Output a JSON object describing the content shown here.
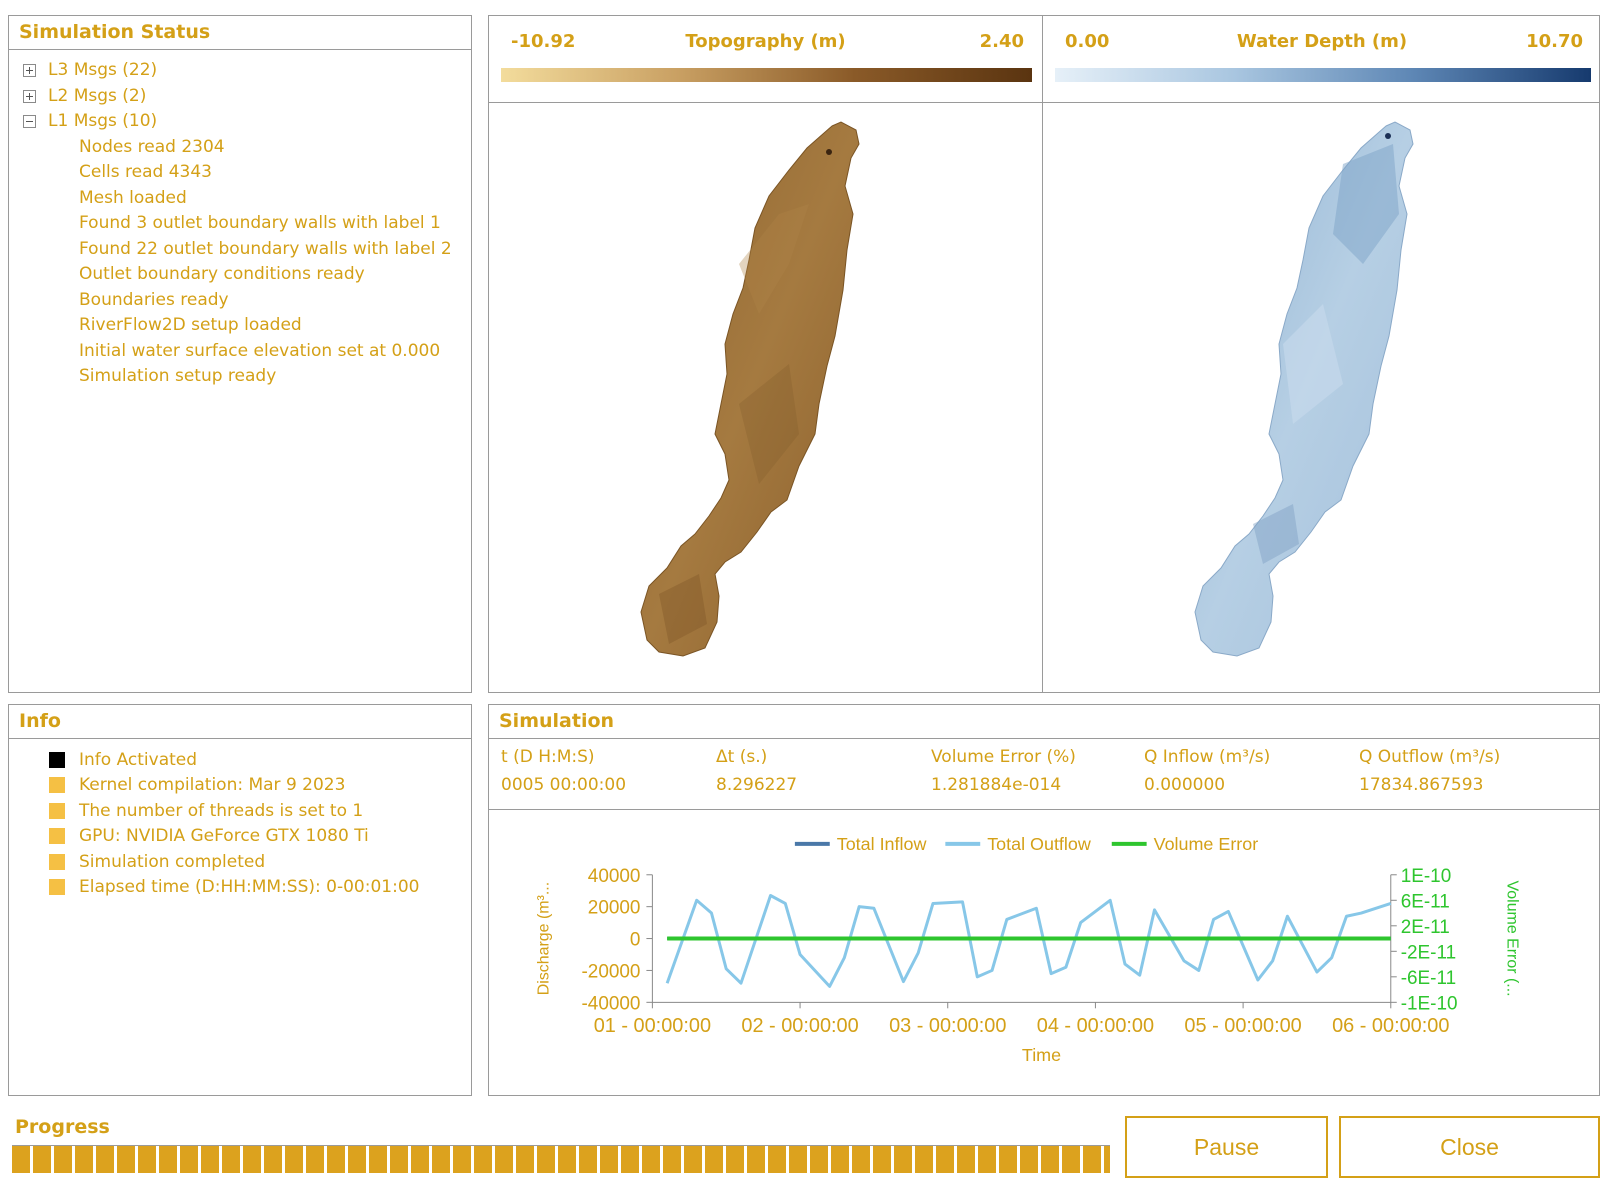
{
  "status_panel": {
    "title": "Simulation Status",
    "groups": [
      {
        "label": "L3 Msgs (22)",
        "expanded": false
      },
      {
        "label": "L2 Msgs (2)",
        "expanded": false
      },
      {
        "label": "L1 Msgs (10)",
        "expanded": true
      }
    ],
    "l1_messages": [
      "Nodes read 2304",
      "Cells read 4343",
      "Mesh loaded",
      "Found 3 outlet boundary walls with label 1",
      "Found 22 outlet boundary walls with label 2",
      "Outlet boundary conditions ready",
      "Boundaries ready",
      "RiverFlow2D setup loaded",
      "Initial water surface elevation set at 0.000",
      "Simulation setup ready"
    ]
  },
  "topography": {
    "title": "Topography (m)",
    "min": "-10.92",
    "max": "2.40"
  },
  "water_depth": {
    "title": "Water Depth (m)",
    "min": "0.00",
    "max": "10.70"
  },
  "info_panel": {
    "title": "Info",
    "items": [
      {
        "text": "Info Activated",
        "color": "#000000"
      },
      {
        "text": "Kernel compilation: Mar  9 2023",
        "color": "#f5c044"
      },
      {
        "text": "The number of threads is set to 1",
        "color": "#f5c044"
      },
      {
        "text": "GPU: NVIDIA GeForce GTX 1080 Ti",
        "color": "#f5c044"
      },
      {
        "text": "Simulation completed",
        "color": "#f5c044"
      },
      {
        "text": "Elapsed time (D:HH:MM:SS): 0-00:01:00",
        "color": "#f5c044"
      }
    ]
  },
  "simulation_panel": {
    "title": "Simulation",
    "headers": {
      "time": "t (D H:M:S)",
      "dt": "Δt (s.)",
      "volume_error": "Volume Error (%)",
      "q_inflow": "Q Inflow (m³/s)",
      "q_outflow": "Q Outflow (m³/s)"
    },
    "values": {
      "time": "0005 00:00:00",
      "dt": "8.296227",
      "volume_error": "1.281884e-014",
      "q_inflow": "0.000000",
      "q_outflow": "17834.867593"
    }
  },
  "chart_data": {
    "type": "line",
    "xlabel": "Time",
    "ylabel": "Discharge (m³...",
    "y2label": "Volume Error (...",
    "ylim": [
      -40000,
      40000
    ],
    "y2lim": [
      -1e-10,
      1e-10
    ],
    "yticks": [
      "40000",
      "20000",
      "0",
      "-20000",
      "-40000"
    ],
    "y2ticks": [
      "1E-10",
      "6E-11",
      "2E-11",
      "-2E-11",
      "-6E-11",
      "-1E-10"
    ],
    "xticks": [
      "01 - 00:00:00",
      "02 - 00:00:00",
      "03 - 00:00:00",
      "04 - 00:00:00",
      "05 - 00:00:00",
      "06 - 00:00:00"
    ],
    "xlim": [
      1.1,
      6.0
    ],
    "legend": {
      "position": "top-center"
    },
    "series": [
      {
        "name": "Total Inflow",
        "color": "#4a78a8",
        "axis": "left",
        "x": [
          1.1,
          6.0
        ],
        "y": [
          0,
          0
        ]
      },
      {
        "name": "Total Outflow",
        "color": "#87c7e8",
        "axis": "left",
        "x": [
          1.1,
          1.3,
          1.4,
          1.5,
          1.6,
          1.8,
          1.9,
          2.0,
          2.2,
          2.3,
          2.4,
          2.5,
          2.7,
          2.8,
          2.9,
          3.1,
          3.2,
          3.3,
          3.4,
          3.6,
          3.7,
          3.8,
          3.9,
          4.1,
          4.2,
          4.3,
          4.4,
          4.6,
          4.7,
          4.8,
          4.9,
          5.1,
          5.2,
          5.3,
          5.5,
          5.6,
          5.7,
          5.8,
          6.0
        ],
        "y": [
          -28000,
          24000,
          16000,
          -19000,
          -28000,
          27000,
          22000,
          -10000,
          -30000,
          -12000,
          20000,
          19000,
          -27000,
          -9000,
          22000,
          23000,
          -24000,
          -20000,
          12000,
          19000,
          -22000,
          -18000,
          10000,
          24000,
          -16000,
          -23000,
          18000,
          -14000,
          -20000,
          12000,
          17000,
          -26000,
          -14000,
          14000,
          -21000,
          -12000,
          14000,
          16000,
          22000
        ]
      },
      {
        "name": "Volume Error",
        "color": "#2ec52e",
        "axis": "right",
        "x": [
          1.1,
          6.0
        ],
        "y": [
          0,
          0
        ]
      }
    ]
  },
  "progress": {
    "label": "Progress",
    "value": 1.0
  },
  "buttons": {
    "pause": "Pause",
    "close": "Close"
  }
}
